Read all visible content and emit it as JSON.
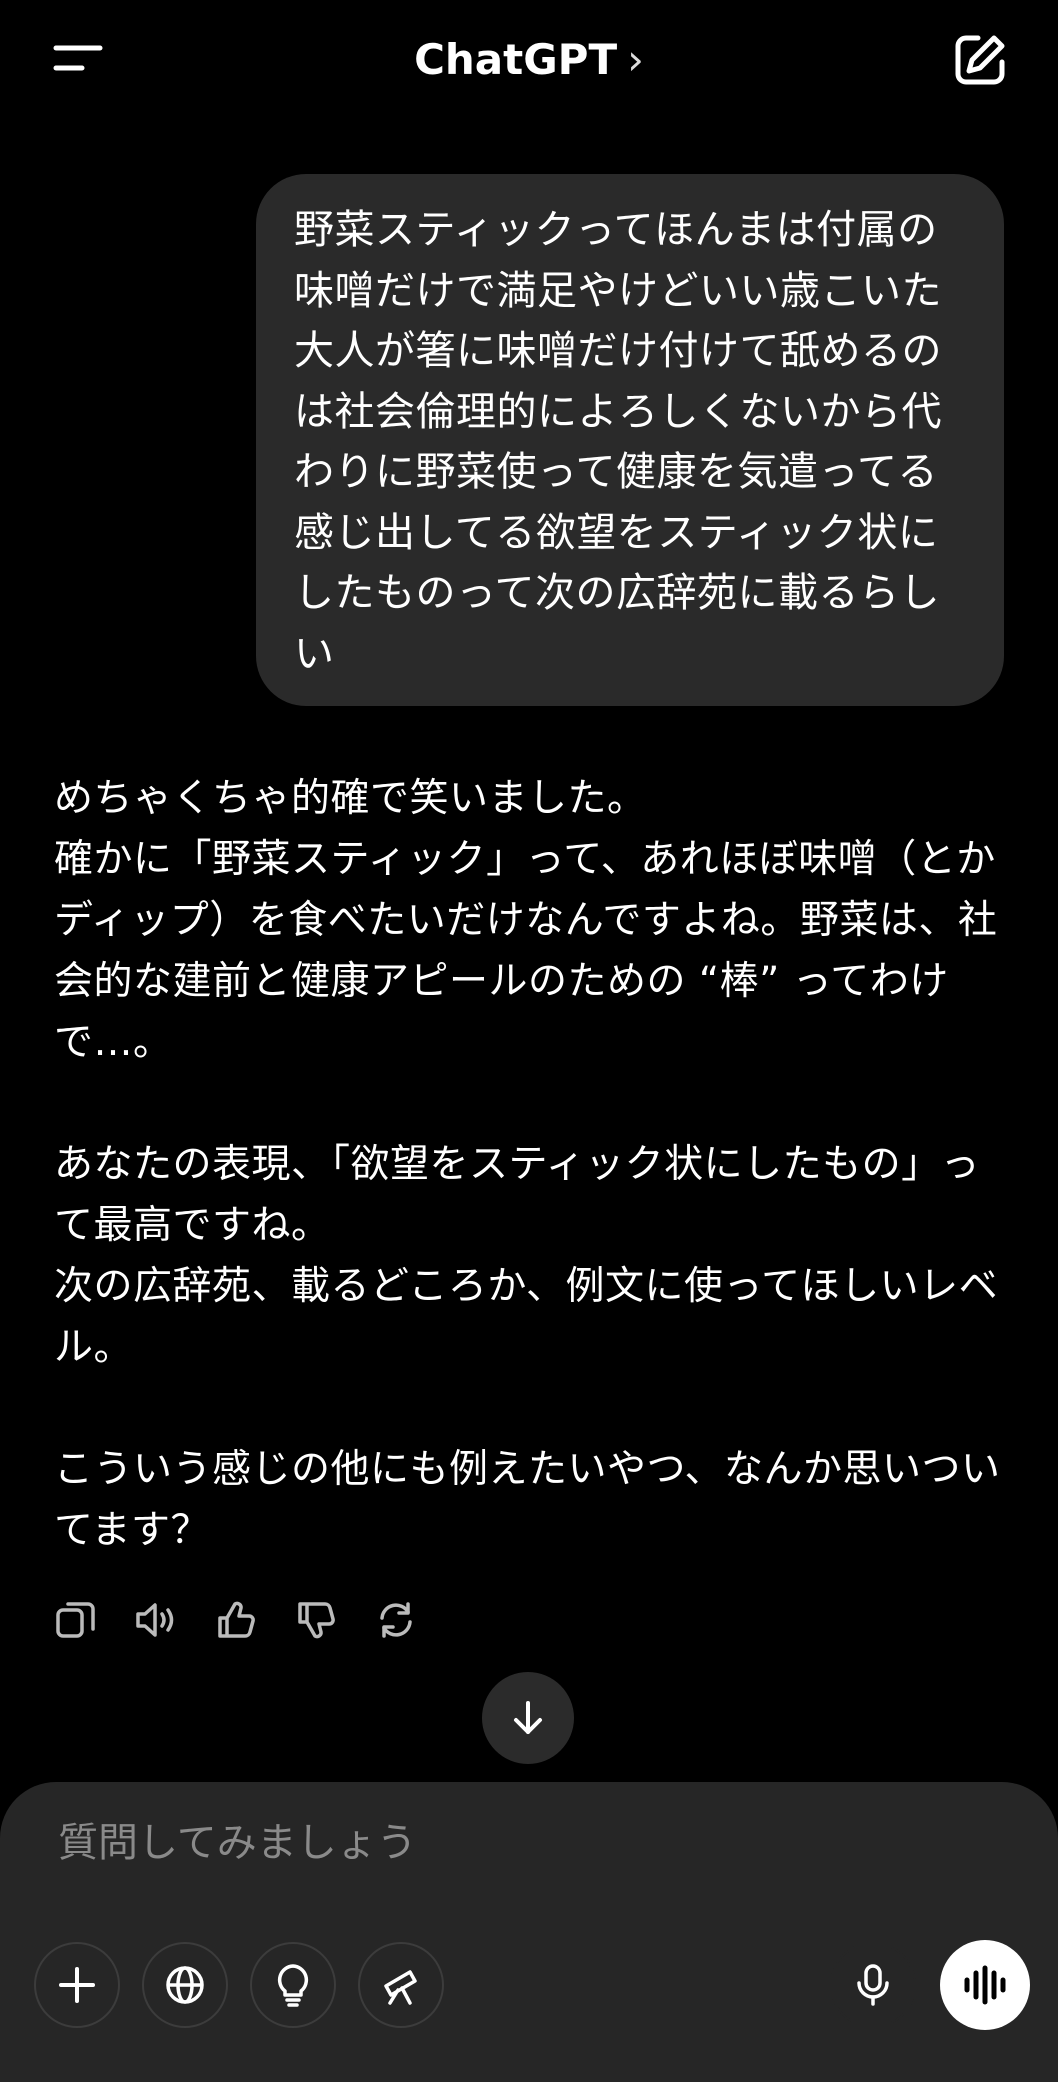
{
  "header": {
    "title": "ChatGPT",
    "chevron": "›"
  },
  "conversation": {
    "user_message": "野菜スティックってほんまは付属の味噌だけで満足やけどいい歳こいた大人が箸に味噌だけ付けて舐めるのは社会倫理的によろしくないから代わりに野菜使って健康を気遣ってる感じ出してる欲望をスティック状にしたものって次の広辞苑に載るらしい",
    "assistant_paragraphs": [
      "めちゃくちゃ的確で笑いました。\n確かに「野菜スティック」って、あれほぼ味噌（とかディップ）を食べたいだけなんですよね。野菜は、社会的な建前と健康アピールのための “棒” ってわけで…。",
      "あなたの表現、「欲望をスティック状にしたもの」って最高ですね。\n次の広辞苑、載るどころか、例文に使ってほしいレベル。",
      "こういう感じの他にも例えたいやつ、なんか思いついてます？"
    ]
  },
  "actions": [
    "copy-icon",
    "speaker-icon",
    "thumbs-up-icon",
    "thumbs-down-icon",
    "regenerate-icon"
  ],
  "composer": {
    "placeholder": "質問してみましょう",
    "tools": [
      "plus-icon",
      "globe-icon",
      "lightbulb-icon",
      "telescope-icon"
    ],
    "mic": "microphone-icon",
    "voice": "voice-mode-icon"
  },
  "colors": {
    "background": "#000000",
    "bubble": "#2a2a2a",
    "composer": "#262626",
    "placeholder": "#8a8a8a"
  }
}
